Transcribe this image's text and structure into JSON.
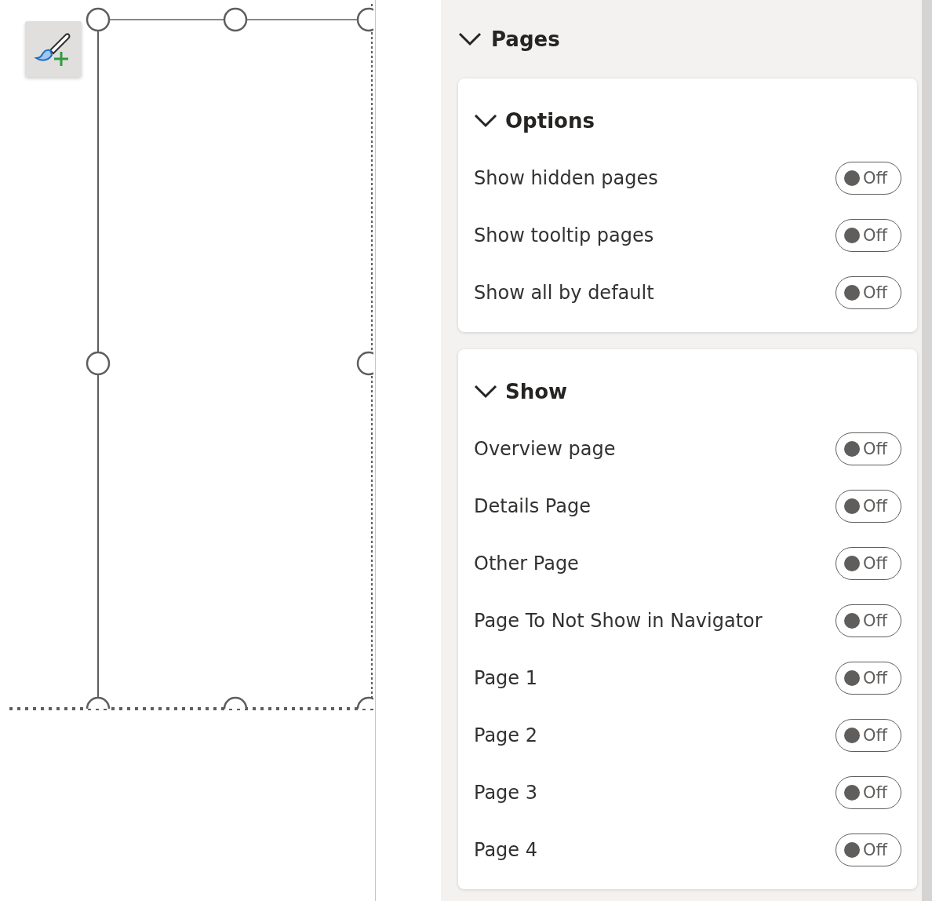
{
  "pane": {
    "title": "Pages",
    "expanded": true,
    "sections": [
      {
        "title": "Options",
        "expanded": true,
        "items": [
          {
            "label": "Show hidden pages",
            "on": false,
            "state_text": "Off"
          },
          {
            "label": "Show tooltip pages",
            "on": false,
            "state_text": "Off"
          },
          {
            "label": "Show all by default",
            "on": false,
            "state_text": "Off"
          }
        ]
      },
      {
        "title": "Show",
        "expanded": true,
        "items": [
          {
            "label": "Overview page",
            "on": false,
            "state_text": "Off"
          },
          {
            "label": "Details Page",
            "on": false,
            "state_text": "Off"
          },
          {
            "label": "Other Page",
            "on": false,
            "state_text": "Off"
          },
          {
            "label": "Page To Not Show in Navigator",
            "on": false,
            "state_text": "Off"
          },
          {
            "label": "Page 1",
            "on": false,
            "state_text": "Off"
          },
          {
            "label": "Page 2",
            "on": false,
            "state_text": "Off"
          },
          {
            "label": "Page 3",
            "on": false,
            "state_text": "Off"
          },
          {
            "label": "Page 4",
            "on": false,
            "state_text": "Off"
          }
        ]
      }
    ]
  }
}
